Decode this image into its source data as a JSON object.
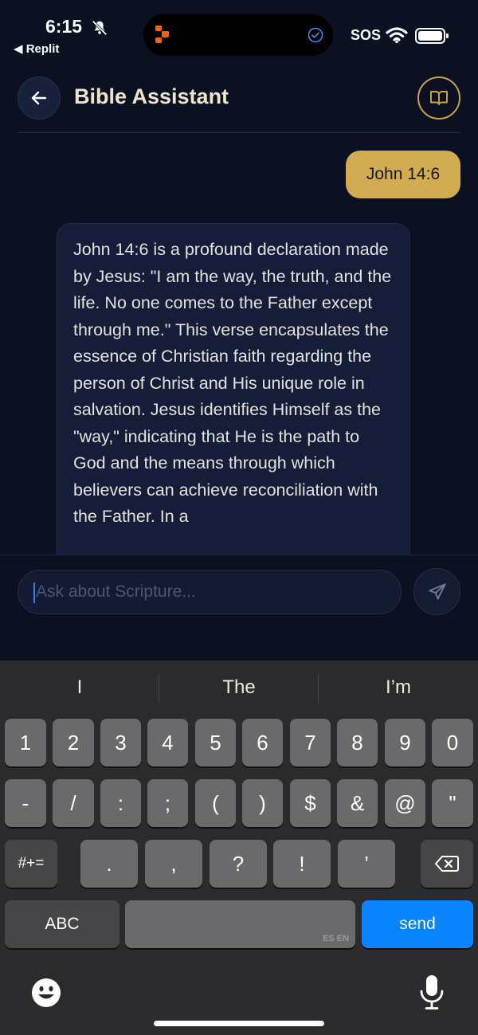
{
  "status_bar": {
    "time": "6:15",
    "back_app": "◀ Replit",
    "sos": "SOS"
  },
  "header": {
    "title": "Bible Assistant"
  },
  "chat": {
    "user_message": "John 14:6",
    "assistant_message": "John 14:6 is a profound declaration made by Jesus: \"I am the way, the truth, and the life. No one comes to the Father except through me.\" This verse encapsulates the essence of Christian faith regarding the person of Christ and His unique role in salvation. Jesus identifies Himself as the \"way,\" indicating that He is the path to God and the means through which believers can achieve reconciliation with the Father. In a"
  },
  "composer": {
    "placeholder": "Ask about Scripture..."
  },
  "keyboard": {
    "suggestions": [
      "I",
      "The",
      "I’m"
    ],
    "row1": [
      "1",
      "2",
      "3",
      "4",
      "5",
      "6",
      "7",
      "8",
      "9",
      "0"
    ],
    "row2": [
      "-",
      "/",
      ":",
      ";",
      "(",
      ")",
      "$",
      "&",
      "@",
      "\""
    ],
    "row3_left": "#+=",
    "row3": [
      ".",
      ",",
      "?",
      "!",
      "’"
    ],
    "abc": "ABC",
    "space_lang": "ES EN",
    "send": "send"
  },
  "colors": {
    "background": "#0c1122",
    "accent_gold": "#d2ac52",
    "bubble": "#151d38",
    "keyboard_send": "#0a84ff"
  },
  "icons": {
    "back": "arrow-left-icon",
    "book": "book-open-icon",
    "send": "paper-plane-icon",
    "emoji": "emoji-icon",
    "mic": "microphone-icon",
    "delete": "backspace-icon"
  }
}
